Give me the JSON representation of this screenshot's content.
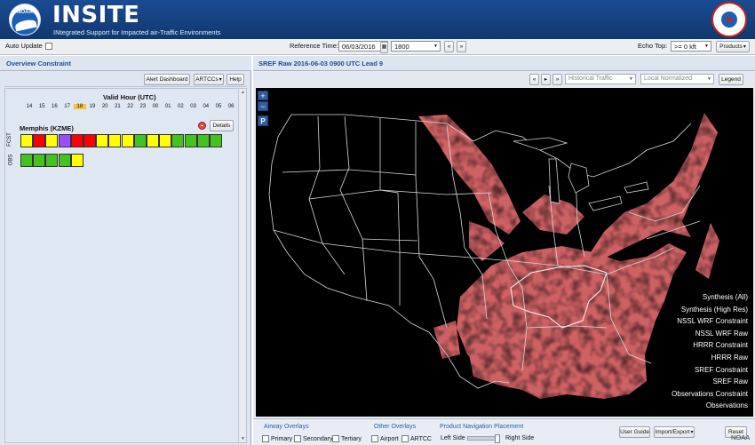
{
  "header": {
    "logo_text": "NOAA",
    "title": "INSITE",
    "subtitle": "INtegrated Support for Impacted air-Traffic Environments"
  },
  "toolbar": {
    "auto_update_label": "Auto Update",
    "reference_time_label": "Reference Time:",
    "reference_date": "06/03/2016",
    "reference_hour": "1800",
    "echo_top_label": "Echo Top:",
    "echo_top_value": ">= 0 kft",
    "products_label": "Products"
  },
  "left_panel": {
    "title": "Overview Constraint",
    "alert_dashboard": "Alert Dashboard",
    "artccs": "ARTCCs",
    "help": "Help",
    "valid_hour_label": "Valid Hour (UTC)",
    "hours": [
      "14",
      "15",
      "16",
      "17",
      "18",
      "19",
      "20",
      "21",
      "22",
      "23",
      "00",
      "01",
      "02",
      "03",
      "04",
      "05",
      "06"
    ],
    "selected_hour": "18",
    "site": "Memphis (KZME)",
    "details": "Details",
    "fcst_label": "FCST",
    "obs_label": "OBS",
    "fcst_colors": [
      "#ffff00",
      "#ff0000",
      "#ffff00",
      "#9a4dff",
      "#ff0000",
      "#ff0000",
      "#ffff00",
      "#ffff00",
      "#ffff00",
      "#44c21f",
      "#ffff00",
      "#ffff00",
      "#44c21f",
      "#44c21f",
      "#44c21f",
      "#44c21f"
    ],
    "obs_colors": [
      "#44c21f",
      "#44c21f",
      "#44c21f",
      "#44c21f",
      "#ffff00"
    ]
  },
  "map_panel": {
    "title": "SREF Raw 2016-06-03 0900 UTC Lead 9",
    "historical_traffic": "Historical Traffic",
    "local_normalized": "Local Normalized",
    "legend_button": "Legend",
    "product_list": [
      "Synthesis (All)",
      "Synthesis (High Res)",
      "NSSL WRF Constraint",
      "NSSL WRF Raw",
      "HRRR Constraint",
      "HRRR Raw",
      "SREF Constraint",
      "SREF Raw",
      "Observations Constraint",
      "Observations"
    ],
    "zoom_in": "+",
    "zoom_out": "−",
    "p_button": "P"
  },
  "bottom": {
    "airway_overlays": "Airway Overlays",
    "primary": "Primary",
    "secondary": "Secondary",
    "tertiary": "Tertiary",
    "other_overlays": "Other Overlays",
    "airport": "Airport",
    "artcc": "ARTCC",
    "product_nav": "Product Navigation Placement",
    "left_side": "Left Side",
    "right_side": "Right Side",
    "user_guide": "User Guide",
    "import_export": "Import/Export",
    "reset": "Reset",
    "footer_noaa": "NOAA"
  },
  "colors": {
    "header_blue": "#10386f",
    "constraint_pink": "#d9676a",
    "selected_hour": "#f6c23a"
  }
}
